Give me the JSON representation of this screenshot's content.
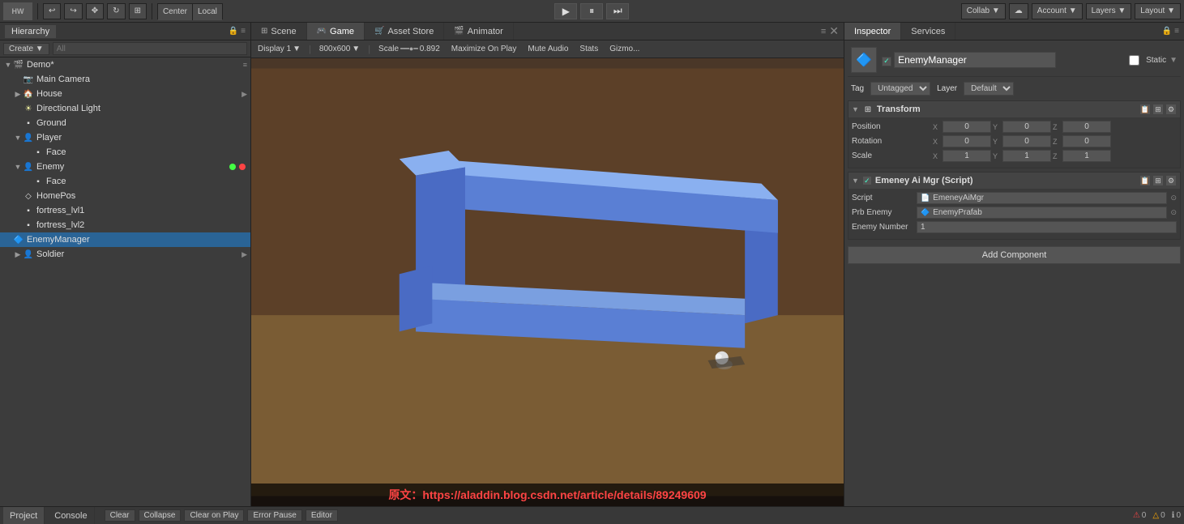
{
  "topbar": {
    "logo": "HW",
    "buttons": [
      "undo",
      "redo",
      "transform-move",
      "transform-rotate",
      "transform-scale"
    ],
    "center_label": "Center",
    "local_label": "Local",
    "play": "▶",
    "pause": "⏸",
    "step": "⏭",
    "collab": "Collab ▼",
    "cloud": "☁",
    "account": "Account ▼",
    "layers": "Layers ▼",
    "layout": "Layout ▼"
  },
  "hierarchy": {
    "title": "Hierarchy",
    "create_label": "Create ▼",
    "search_placeholder": "All",
    "scene_name": "Demo*",
    "items": [
      {
        "id": "main-camera",
        "label": "Main Camera",
        "indent": 1,
        "has_expand": false,
        "icon": "📷"
      },
      {
        "id": "house",
        "label": "House",
        "indent": 1,
        "has_expand": true,
        "icon": "🏠"
      },
      {
        "id": "directional-light",
        "label": "Directional Light",
        "indent": 1,
        "has_expand": false,
        "icon": "☀"
      },
      {
        "id": "ground",
        "label": "Ground",
        "indent": 1,
        "has_expand": false,
        "icon": "▪"
      },
      {
        "id": "player",
        "label": "Player",
        "indent": 1,
        "has_expand": true,
        "icon": "👤"
      },
      {
        "id": "face-player",
        "label": "Face",
        "indent": 2,
        "has_expand": false,
        "icon": "▪"
      },
      {
        "id": "enemy",
        "label": "Enemy",
        "indent": 1,
        "has_expand": true,
        "icon": "👤",
        "has_dots": true
      },
      {
        "id": "face-enemy",
        "label": "Face",
        "indent": 2,
        "has_expand": false,
        "icon": "▪"
      },
      {
        "id": "homepos",
        "label": "HomePos",
        "indent": 1,
        "has_expand": false,
        "icon": "◇"
      },
      {
        "id": "fortress1",
        "label": "fortress_lvl1",
        "indent": 1,
        "has_expand": false,
        "icon": "▪"
      },
      {
        "id": "fortress2",
        "label": "fortress_lvl2",
        "indent": 1,
        "has_expand": false,
        "icon": "▪"
      },
      {
        "id": "enemy-manager",
        "label": "EnemyManager",
        "indent": 0,
        "has_expand": false,
        "icon": "🔷",
        "selected": true
      },
      {
        "id": "soldier",
        "label": "Soldier",
        "indent": 1,
        "has_expand": true,
        "icon": "👤"
      }
    ]
  },
  "tabs": {
    "scene": "Scene",
    "game": "Game",
    "asset_store": "Asset Store",
    "animator": "Animator"
  },
  "game_toolbar": {
    "display": "Display 1",
    "resolution": "800x600",
    "scale_label": "Scale",
    "scale_value": "0.892",
    "maximize_on_play": "Maximize On Play",
    "mute_audio": "Mute Audio",
    "stats": "Stats",
    "gizmos": "Gizmo..."
  },
  "inspector": {
    "title": "Inspector",
    "services": "Services",
    "object_name": "EnemyManager",
    "static_label": "Static",
    "tag_label": "Tag",
    "tag_value": "Untagged",
    "layer_label": "Layer",
    "layer_value": "Default",
    "transform": {
      "title": "Transform",
      "position_label": "Position",
      "rotation_label": "Rotation",
      "scale_label": "Scale",
      "pos_x": "0",
      "pos_y": "0",
      "pos_z": "0",
      "rot_x": "0",
      "rot_y": "0",
      "rot_z": "0",
      "scale_x": "1",
      "scale_y": "1",
      "scale_z": "1"
    },
    "script_component": {
      "title": "Emeney Ai Mgr (Script)",
      "script_label": "Script",
      "script_value": "EmeneyAiMgr",
      "prb_enemy_label": "Prb Enemy",
      "prb_enemy_value": "EnemyPrafab",
      "enemy_number_label": "Enemy Number",
      "enemy_number_value": "1"
    },
    "add_component": "Add Component"
  },
  "bottom": {
    "project_tab": "Project",
    "console_tab": "Console",
    "clear_btn": "Clear",
    "collapse_btn": "Collapse",
    "clear_on_play_btn": "Clear on Play",
    "error_pause_btn": "Error Pause",
    "editor_btn": "Editor",
    "status_errors": "0",
    "status_warnings": "0",
    "status_messages": "0"
  },
  "watermark": "原文：https://aladdin.blog.csdn.net/article/details/89249609"
}
